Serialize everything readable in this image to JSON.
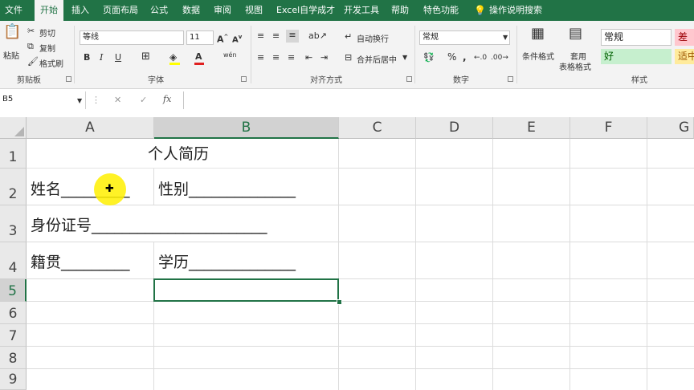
{
  "tabs": [
    "文件",
    "开始",
    "插入",
    "页面布局",
    "公式",
    "数据",
    "审阅",
    "视图",
    "Excel自学成才",
    "开发工具",
    "帮助",
    "特色功能",
    "操作说明搜索"
  ],
  "clipboard": {
    "paste": "粘贴",
    "cut": "剪切",
    "copy": "复制",
    "format_painter": "格式刷",
    "group": "剪贴板"
  },
  "font": {
    "name": "等线",
    "size": "11",
    "bold": "B",
    "italic": "I",
    "underline": "U",
    "wen": "wén",
    "group": "字体"
  },
  "alignment": {
    "wrap": "自动换行",
    "merge": "合并后居中",
    "group": "对齐方式"
  },
  "number": {
    "format": "常规",
    "percent": "%",
    "comma": ",",
    "group": "数字"
  },
  "styles": {
    "conditional": "条件格式",
    "table_format_1": "套用",
    "table_format_2": "表格格式",
    "normal": "常规",
    "bad": "差",
    "good": "好",
    "neutral": "适中",
    "group": "样式"
  },
  "formula_bar": {
    "name_box": "B5",
    "fx": "fx",
    "cancel": "✕",
    "enter": "✓"
  },
  "columns": [
    "A",
    "B",
    "C",
    "D",
    "E",
    "F",
    "G"
  ],
  "rows": [
    "1",
    "2",
    "3",
    "4",
    "5",
    "6",
    "7",
    "8",
    "9"
  ],
  "cells": {
    "title": "个人简历",
    "name": "姓名_________",
    "gender": "性别______________",
    "id": "身份证号_______________________",
    "native": "籍贯_________",
    "education": "学历______________"
  },
  "colors": {
    "ribbon": "#217346",
    "good_fill": "#c6efce",
    "bad_fill": "#ffc7ce",
    "neutral_fill": "#ffeb9c"
  }
}
